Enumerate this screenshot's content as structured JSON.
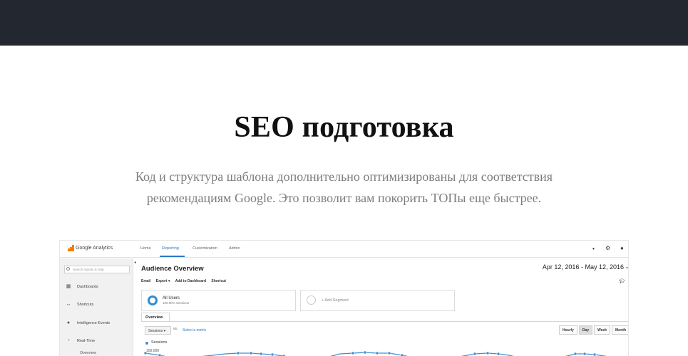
{
  "heading": "SEO подготовка",
  "description": {
    "line1": "Код и структура шаблона дополнительно оптимизированы для соответствия",
    "line2": "рекомендациям Google. Это позволит вам покорить ТОПы еще быстрее."
  },
  "ga": {
    "brand": "Google Analytics",
    "nav": [
      "Home",
      "Reporting",
      "Customization",
      "Admin"
    ],
    "search_placeholder": "Search reports & help",
    "sidebar": [
      {
        "label": "Dashboards",
        "icon": "grid-icon"
      },
      {
        "label": "Shortcuts",
        "icon": "arrows-icon"
      },
      {
        "label": "Intelligence Events",
        "icon": "bulb-icon"
      },
      {
        "label": "Real-Time",
        "icon": "clock-icon"
      }
    ],
    "sidebar_sub": "Overview",
    "page_title": "Audience Overview",
    "date_range": "Apr 12, 2016 - May 12, 2016",
    "toolbar": [
      "Email",
      "Export ▾",
      "Add to Dashboard",
      "Shortcut"
    ],
    "segment1": {
      "title": "All Users",
      "sub": "100.00% Sessions"
    },
    "segment2": {
      "title": "+ Add Segment"
    },
    "tab": "Overview",
    "metric_select": "Sessions",
    "vs": "vs.",
    "select_metric": "Select a metric",
    "granularity": [
      "Hourly",
      "Day",
      "Week",
      "Month"
    ],
    "granularity_selected": "Day",
    "legend": "Sessions",
    "y_label": "100,000",
    "accent": "#2b78c5",
    "series_color": "#3d8fd1"
  }
}
